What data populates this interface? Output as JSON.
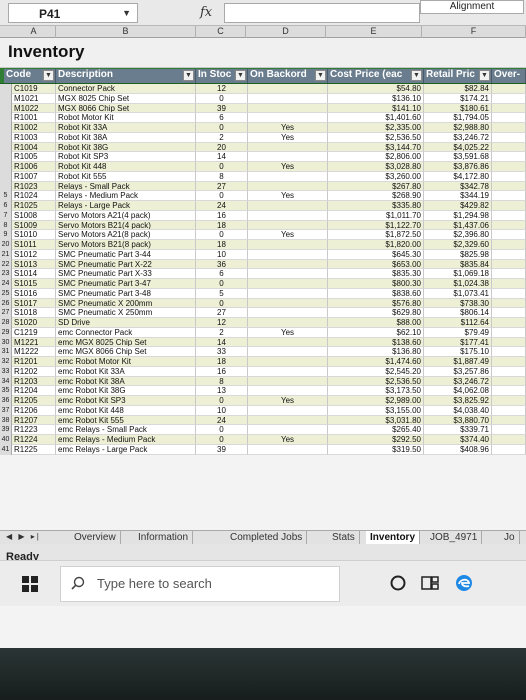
{
  "formula_bar": {
    "name_box": "P41",
    "fx": "fx",
    "value": "Alignment"
  },
  "column_letters": [
    "A",
    "B",
    "C",
    "D",
    "E",
    "F"
  ],
  "title": "Inventory",
  "headers": {
    "code": "Code",
    "description": "Description",
    "in_stock": "In Stoc",
    "on_backorder": "On Backord",
    "cost_price": "Cost Price (eac",
    "retail_price": "Retail Pric",
    "over": "Over-"
  },
  "rows": [
    {
      "n": "",
      "code": "C1019",
      "desc": "Connector Pack",
      "stock": "12",
      "back": "",
      "cost": "$54.80",
      "retail": "$82.84"
    },
    {
      "n": "",
      "code": "M1021",
      "desc": "MGX 8025 Chip Set",
      "stock": "0",
      "back": "",
      "cost": "$136.10",
      "retail": "$174.21"
    },
    {
      "n": "",
      "code": "M1022",
      "desc": "MGX 8066 Chip Set",
      "stock": "39",
      "back": "",
      "cost": "$141.10",
      "retail": "$180.61"
    },
    {
      "n": "",
      "code": "R1001",
      "desc": "Robot Motor Kit",
      "stock": "6",
      "back": "",
      "cost": "$1,401.60",
      "retail": "$1,794.05"
    },
    {
      "n": "",
      "code": "R1002",
      "desc": "Robot Kit 33A",
      "stock": "0",
      "back": "Yes",
      "cost": "$2,335.00",
      "retail": "$2,988.80"
    },
    {
      "n": "",
      "code": "R1003",
      "desc": "Robot Kit 38A",
      "stock": "2",
      "back": "Yes",
      "cost": "$2,536.50",
      "retail": "$3,246.72"
    },
    {
      "n": "",
      "code": "R1004",
      "desc": "Robot Kit 38G",
      "stock": "20",
      "back": "",
      "cost": "$3,144.70",
      "retail": "$4,025.22"
    },
    {
      "n": "",
      "code": "R1005",
      "desc": "Robot Kit SP3",
      "stock": "14",
      "back": "",
      "cost": "$2,806.00",
      "retail": "$3,591.68"
    },
    {
      "n": "",
      "code": "R1006",
      "desc": "Robot Kit 448",
      "stock": "0",
      "back": "Yes",
      "cost": "$3,028.80",
      "retail": "$3,876.86"
    },
    {
      "n": "",
      "code": "R1007",
      "desc": "Robot Kit 555",
      "stock": "8",
      "back": "",
      "cost": "$3,260.00",
      "retail": "$4,172.80"
    },
    {
      "n": "",
      "code": "R1023",
      "desc": "Relays - Small Pack",
      "stock": "27",
      "back": "",
      "cost": "$267.80",
      "retail": "$342.78"
    },
    {
      "n": "5",
      "code": "R1024",
      "desc": "Relays - Medium Pack",
      "stock": "0",
      "back": "Yes",
      "cost": "$268.90",
      "retail": "$344.19"
    },
    {
      "n": "6",
      "code": "R1025",
      "desc": "Relays - Large Pack",
      "stock": "24",
      "back": "",
      "cost": "$335.80",
      "retail": "$429.82"
    },
    {
      "n": "7",
      "code": "S1008",
      "desc": "Servo Motors A21(4 pack)",
      "stock": "16",
      "back": "",
      "cost": "$1,011.70",
      "retail": "$1,294.98"
    },
    {
      "n": "8",
      "code": "S1009",
      "desc": "Servo Motors B21(4 pack)",
      "stock": "18",
      "back": "",
      "cost": "$1,122.70",
      "retail": "$1,437.06"
    },
    {
      "n": "9",
      "code": "S1010",
      "desc": "Servo Motors A21(8 pack)",
      "stock": "0",
      "back": "Yes",
      "cost": "$1,872.50",
      "retail": "$2,396.80"
    },
    {
      "n": "20",
      "code": "S1011",
      "desc": "Servo Motors B21(8 pack)",
      "stock": "18",
      "back": "",
      "cost": "$1,820.00",
      "retail": "$2,329.60"
    },
    {
      "n": "21",
      "code": "S1012",
      "desc": "SMC Pneumatic Part 3-44",
      "stock": "10",
      "back": "",
      "cost": "$645.30",
      "retail": "$825.98"
    },
    {
      "n": "22",
      "code": "S1013",
      "desc": "SMC Pneumatic Part X-22",
      "stock": "36",
      "back": "",
      "cost": "$653.00",
      "retail": "$835.84"
    },
    {
      "n": "23",
      "code": "S1014",
      "desc": "SMC Pneumatic Part X-33",
      "stock": "6",
      "back": "",
      "cost": "$835.30",
      "retail": "$1,069.18"
    },
    {
      "n": "24",
      "code": "S1015",
      "desc": "SMC Pneumatic Part 3-47",
      "stock": "0",
      "back": "",
      "cost": "$800.30",
      "retail": "$1,024.38"
    },
    {
      "n": "25",
      "code": "S1016",
      "desc": "SMC Pneumatic Part 3-48",
      "stock": "5",
      "back": "",
      "cost": "$838.60",
      "retail": "$1,073.41"
    },
    {
      "n": "26",
      "code": "S1017",
      "desc": "SMC Pneumatic X 200mm",
      "stock": "0",
      "back": "",
      "cost": "$576.80",
      "retail": "$738.30"
    },
    {
      "n": "27",
      "code": "S1018",
      "desc": "SMC Pneumatic X 250mm",
      "stock": "27",
      "back": "",
      "cost": "$629.80",
      "retail": "$806.14"
    },
    {
      "n": "28",
      "code": "S1020",
      "desc": "SD Drive",
      "stock": "12",
      "back": "",
      "cost": "$88.00",
      "retail": "$112.64"
    },
    {
      "n": "29",
      "code": "C1219",
      "desc": "emc Connector Pack",
      "stock": "2",
      "back": "Yes",
      "cost": "$62.10",
      "retail": "$79.49"
    },
    {
      "n": "30",
      "code": "M1221",
      "desc": "emc MGX 8025 Chip Set",
      "stock": "14",
      "back": "",
      "cost": "$138.60",
      "retail": "$177.41"
    },
    {
      "n": "31",
      "code": "M1222",
      "desc": "emc MGX 8066 Chip Set",
      "stock": "33",
      "back": "",
      "cost": "$136.80",
      "retail": "$175.10"
    },
    {
      "n": "32",
      "code": "R1201",
      "desc": "emc Robot Motor Kit",
      "stock": "18",
      "back": "",
      "cost": "$1,474.60",
      "retail": "$1,887.49"
    },
    {
      "n": "33",
      "code": "R1202",
      "desc": "emc Robot Kit 33A",
      "stock": "16",
      "back": "",
      "cost": "$2,545.20",
      "retail": "$3,257.86"
    },
    {
      "n": "34",
      "code": "R1203",
      "desc": "emc Robot Kit 38A",
      "stock": "8",
      "back": "",
      "cost": "$2,536.50",
      "retail": "$3,246.72"
    },
    {
      "n": "35",
      "code": "R1204",
      "desc": "emc Robot Kit 38G",
      "stock": "13",
      "back": "",
      "cost": "$3,173.50",
      "retail": "$4,062.08"
    },
    {
      "n": "36",
      "code": "R1205",
      "desc": "emc Robot Kit SP3",
      "stock": "0",
      "back": "Yes",
      "cost": "$2,989.00",
      "retail": "$3,825.92"
    },
    {
      "n": "37",
      "code": "R1206",
      "desc": "emc Robot Kit 448",
      "stock": "10",
      "back": "",
      "cost": "$3,155.00",
      "retail": "$4,038.40"
    },
    {
      "n": "38",
      "code": "R1207",
      "desc": "emc Robot Kit 555",
      "stock": "24",
      "back": "",
      "cost": "$3,031.80",
      "retail": "$3,880.70"
    },
    {
      "n": "39",
      "code": "R1223",
      "desc": "emc Relays - Small Pack",
      "stock": "0",
      "back": "",
      "cost": "$265.40",
      "retail": "$339.71"
    },
    {
      "n": "40",
      "code": "R1224",
      "desc": "emc Relays - Medium Pack",
      "stock": "0",
      "back": "Yes",
      "cost": "$292.50",
      "retail": "$374.40"
    },
    {
      "n": "41",
      "code": "R1225",
      "desc": "emc Relays - Large Pack",
      "stock": "39",
      "back": "",
      "cost": "$319.50",
      "retail": "$408.96"
    }
  ],
  "sheet_tabs": {
    "nav": "◀ ▶ ▸|",
    "overview": "Overview",
    "information": "Information",
    "completed_jobs": "Completed Jobs",
    "stats": "Stats",
    "inventory": "Inventory",
    "job": "JOB_4971",
    "more": "Jo"
  },
  "status": "Ready",
  "taskbar": {
    "search_placeholder": "Type here to search"
  }
}
